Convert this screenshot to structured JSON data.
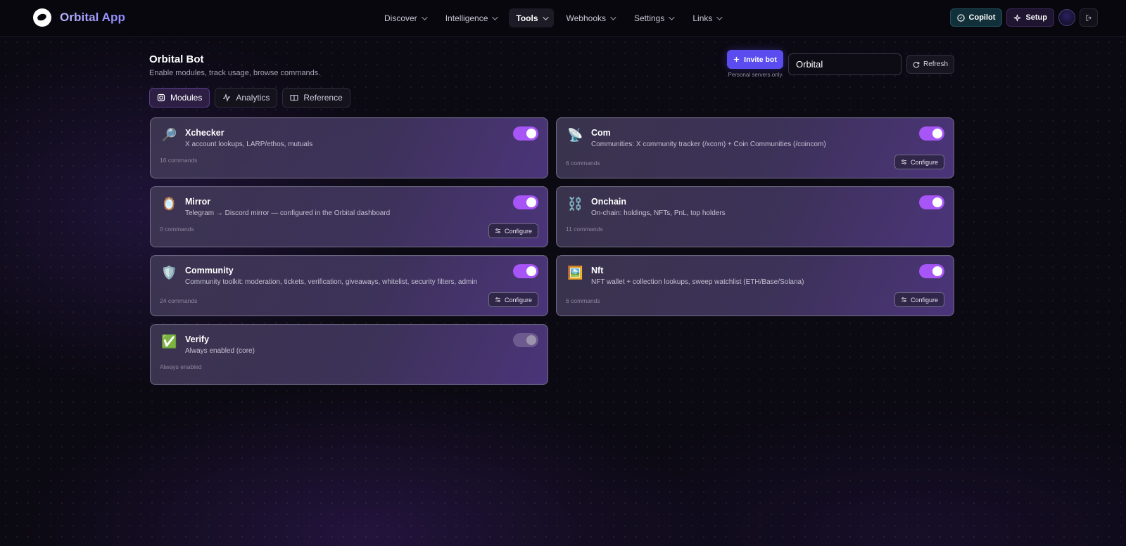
{
  "app": {
    "name": "Orbital App"
  },
  "nav": {
    "items": [
      {
        "label": "Discover",
        "active": false
      },
      {
        "label": "Intelligence",
        "active": false
      },
      {
        "label": "Tools",
        "active": true
      },
      {
        "label": "Webhooks",
        "active": false
      },
      {
        "label": "Settings",
        "active": false
      },
      {
        "label": "Links",
        "active": false
      }
    ],
    "copilot_label": "Copilot",
    "setup_label": "Setup"
  },
  "header": {
    "title": "Orbital Bot",
    "subtitle": "Enable modules, track usage, browse commands.",
    "invite_label": "Invite bot",
    "invite_note": "Personal servers only",
    "server_value": "Orbital",
    "refresh_label": "Refresh"
  },
  "tabs": [
    {
      "label": "Modules",
      "active": true
    },
    {
      "label": "Analytics",
      "active": false
    },
    {
      "label": "Reference",
      "active": false
    }
  ],
  "modules": [
    {
      "name": "Xchecker",
      "description": "X account lookups, LARP/ethos, mutuals",
      "meta": "16 commands",
      "enabled": true,
      "configure": false,
      "icon": "magnifier-icon"
    },
    {
      "name": "Com",
      "description": "Communities: X community tracker (/xcom) + Coin Communities (/coincom)",
      "meta": "6 commands",
      "enabled": true,
      "configure": true,
      "icon": "satellite-icon"
    },
    {
      "name": "Mirror",
      "description": "Telegram → Discord mirror — configured in the Orbital dashboard",
      "meta": "0 commands",
      "enabled": true,
      "configure": true,
      "icon": "mirror-icon"
    },
    {
      "name": "Onchain",
      "description": "On-chain: holdings, NFTs, PnL, top holders",
      "meta": "11 commands",
      "enabled": true,
      "configure": false,
      "icon": "chain-icon"
    },
    {
      "name": "Community",
      "description": "Community toolkit: moderation, tickets, verification, giveaways, whitelist, security filters, admin",
      "meta": "24 commands",
      "enabled": true,
      "configure": true,
      "icon": "shield-icon"
    },
    {
      "name": "Nft",
      "description": "NFT wallet + collection lookups, sweep watchlist (ETH/Base/Solana)",
      "meta": "6 commands",
      "enabled": true,
      "configure": true,
      "icon": "picture-icon"
    },
    {
      "name": "Verify",
      "description": "Always enabled (core)",
      "meta": "Always enabled",
      "enabled": true,
      "locked": true,
      "configure": false,
      "icon": "checkmark-icon"
    }
  ],
  "configure_label": "Configure",
  "colors": {
    "accent": "#a855f7",
    "primary_button": "#5b4cf0"
  }
}
